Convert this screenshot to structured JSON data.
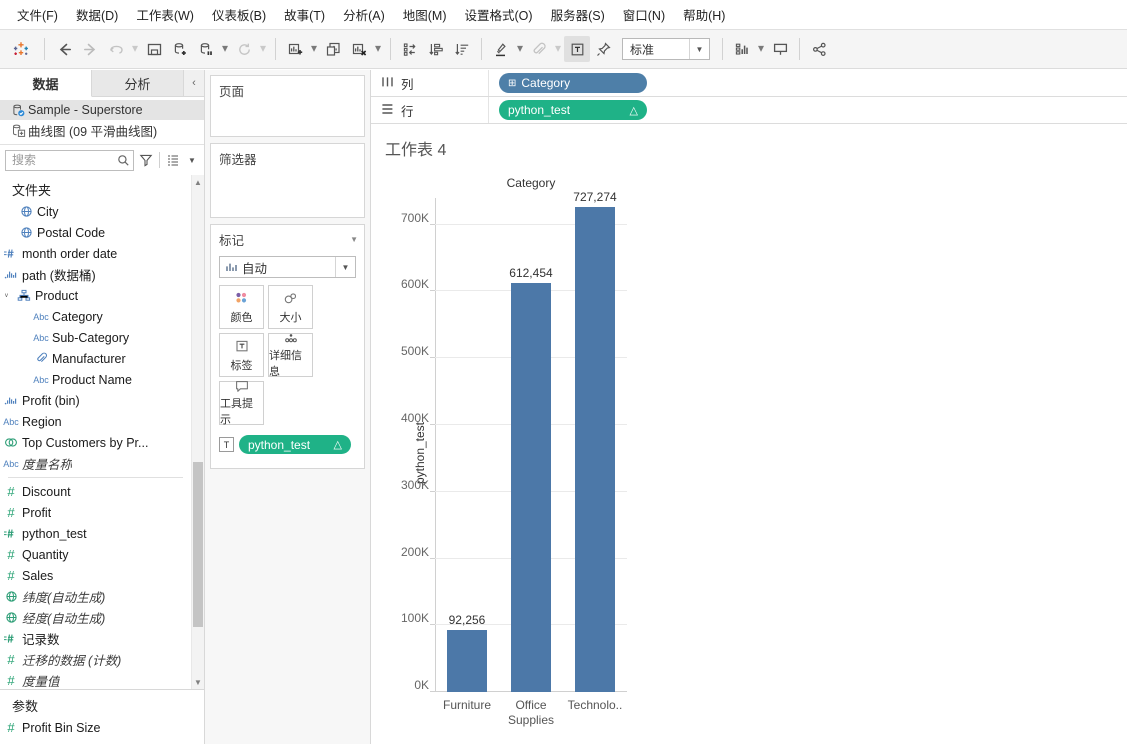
{
  "menu": {
    "items": [
      "文件(F)",
      "数据(D)",
      "工作表(W)",
      "仪表板(B)",
      "故事(T)",
      "分析(A)",
      "地图(M)",
      "设置格式(O)",
      "服务器(S)",
      "窗口(N)",
      "帮助(H)"
    ]
  },
  "toolbar": {
    "fit_value": "标准",
    "icons": [
      "tableau-logo",
      "back-arrow",
      "forward-arrow",
      "undo",
      "save",
      "new-data-source",
      "pause-auto-update",
      "refresh-data",
      "new-worksheet",
      "duplicate-sheet",
      "clear-sheet",
      "swap-rows-columns",
      "sort-ascending",
      "sort-descending",
      "highlight",
      "attachment",
      "show-labels",
      "fix-axis",
      "fit-dropdown",
      "show-hide-cards",
      "presentation-mode",
      "share"
    ]
  },
  "data_pane": {
    "tabs": [
      {
        "label": "数据",
        "selected": true
      },
      {
        "label": "分析",
        "selected": false
      }
    ],
    "collapse_icon": "chevron-left-icon",
    "data_sources": [
      {
        "name": "Sample - Superstore",
        "selected": true,
        "icon": "datasource-connected-icon"
      },
      {
        "name": "曲线图 (09 平滑曲线图)",
        "selected": false,
        "icon": "datasource-add-icon"
      }
    ],
    "search": {
      "placeholder": "搜索",
      "value": ""
    },
    "toolbar_icons": [
      "filter-funnel-icon",
      "list-view-icon",
      "chevron-down-icon"
    ],
    "groups": [
      {
        "header": "文件夹",
        "fields": [
          {
            "name": "City",
            "icon": "globe",
            "kind": "dim",
            "indent": 1
          },
          {
            "name": "Postal Code",
            "icon": "globe",
            "kind": "dim",
            "indent": 1
          },
          {
            "name": "month order date",
            "icon": "calc-hash",
            "kind": "dim",
            "indent": 0
          },
          {
            "name": "path (数据桶)",
            "icon": "bin",
            "kind": "dim",
            "indent": 0
          },
          {
            "name": "Product",
            "icon": "hierarchy",
            "kind": "dim",
            "indent": 0,
            "expander": "chevron-down"
          },
          {
            "name": "Category",
            "icon": "abc",
            "kind": "dim",
            "indent": 2
          },
          {
            "name": "Sub-Category",
            "icon": "abc",
            "kind": "dim",
            "indent": 2
          },
          {
            "name": "Manufacturer",
            "icon": "paperclip",
            "kind": "dim",
            "indent": 2
          },
          {
            "name": "Product Name",
            "icon": "abc",
            "kind": "dim",
            "indent": 2
          },
          {
            "name": "Profit (bin)",
            "icon": "bin",
            "kind": "dim",
            "indent": 0
          },
          {
            "name": "Region",
            "icon": "abc",
            "kind": "dim",
            "indent": 0
          },
          {
            "name": "Top Customers by Pr...",
            "icon": "set",
            "kind": "dim",
            "indent": 0
          },
          {
            "name": "度量名称",
            "icon": "abc",
            "kind": "dim",
            "indent": 0,
            "italic": true
          }
        ]
      },
      {
        "header": "",
        "separator": true,
        "fields": [
          {
            "name": "Discount",
            "icon": "hash",
            "kind": "mea",
            "indent": 0
          },
          {
            "name": "Profit",
            "icon": "hash",
            "kind": "mea",
            "indent": 0
          },
          {
            "name": "python_test",
            "icon": "calc-hash",
            "kind": "mea",
            "indent": 0
          },
          {
            "name": "Quantity",
            "icon": "hash",
            "kind": "mea",
            "indent": 0
          },
          {
            "name": "Sales",
            "icon": "hash",
            "kind": "mea",
            "indent": 0
          },
          {
            "name": "纬度(自动生成)",
            "icon": "globe",
            "kind": "mea",
            "indent": 0,
            "italic": true
          },
          {
            "name": "经度(自动生成)",
            "icon": "globe",
            "kind": "mea",
            "indent": 0,
            "italic": true
          },
          {
            "name": "记录数",
            "icon": "calc-hash",
            "kind": "mea",
            "indent": 0
          },
          {
            "name": "迁移的数据 (计数)",
            "icon": "hash",
            "kind": "mea",
            "indent": 0,
            "italic": true
          },
          {
            "name": "度量值",
            "icon": "hash",
            "kind": "mea",
            "indent": 0,
            "italic": true
          }
        ]
      }
    ],
    "parameters": {
      "header": "参数",
      "fields": [
        {
          "name": "Profit Bin Size",
          "icon": "hash",
          "kind": "mea",
          "indent": 0
        }
      ]
    }
  },
  "cards": {
    "pages": {
      "title": "页面"
    },
    "filters": {
      "title": "筛选器"
    },
    "marks": {
      "title": "标记",
      "type_value": "自动",
      "type_icon": "bar-chart-icon",
      "buttons": [
        {
          "label": "颜色",
          "icon": "color-palette-icon"
        },
        {
          "label": "大小",
          "icon": "size-circles-icon"
        },
        {
          "label": "标签",
          "icon": "text-label-icon"
        },
        {
          "label": "详细信息",
          "icon": "detail-dots-icon"
        },
        {
          "label": "工具提示",
          "icon": "tooltip-bubble-icon"
        }
      ],
      "pill": {
        "label": "python_test",
        "badge": "T",
        "delta": "△",
        "color": "#1fb287"
      }
    }
  },
  "shelves": {
    "columns": {
      "label": "列",
      "icon": "columns-icon",
      "pill": {
        "label": "Category",
        "icon": "⊞",
        "color": "#4e7fa8"
      }
    },
    "rows": {
      "label": "行",
      "icon": "rows-icon",
      "pill": {
        "label": "python_test",
        "delta": "△",
        "color": "#1fb287"
      }
    }
  },
  "view": {
    "worksheet_title": "工作表 4"
  },
  "chart_data": {
    "type": "bar",
    "title": "",
    "column_header": "Category",
    "categories": [
      "Furniture",
      "Office Supplies",
      "Technolo.."
    ],
    "category_labels": [
      [
        "Furniture"
      ],
      [
        "Office",
        "Supplies"
      ],
      [
        "Technolo.."
      ]
    ],
    "values": [
      92256,
      612454,
      727274
    ],
    "value_labels": [
      "92,256",
      "612,454",
      "727,274"
    ],
    "xlabel": "Category",
    "ylabel": "python_test",
    "ylim": [
      0,
      740000
    ],
    "yticks": [
      0,
      100000,
      200000,
      300000,
      400000,
      500000,
      600000,
      700000
    ],
    "ytick_labels": [
      "0K",
      "100K",
      "200K",
      "300K",
      "400K",
      "500K",
      "600K",
      "700K"
    ],
    "bar_color": "#4c78a8",
    "grid": true,
    "legend": "none"
  }
}
